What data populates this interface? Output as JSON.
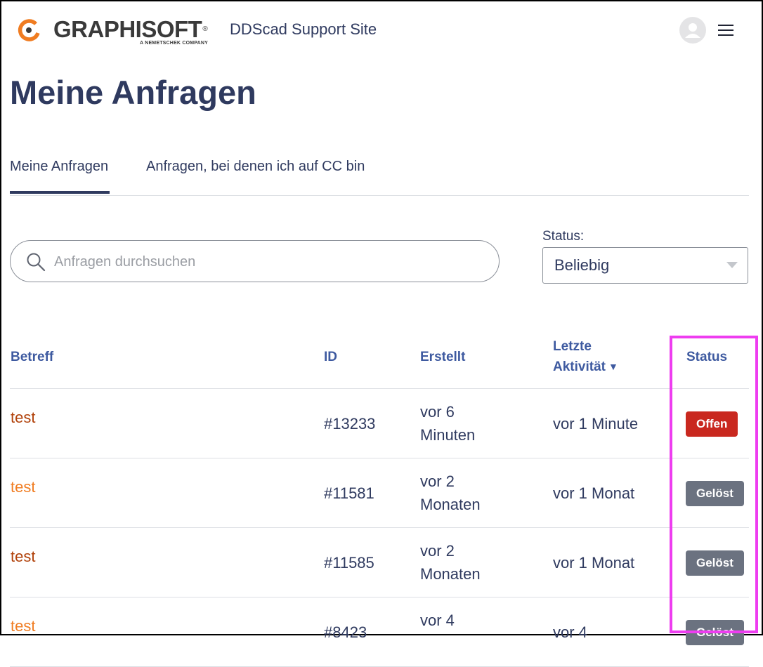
{
  "header": {
    "logo": {
      "wordmark": "GRAPHISOFT",
      "registered": "®",
      "tagline": "A NEMETSCHEK COMPANY"
    },
    "site_name": "DDScad Support Site"
  },
  "page": {
    "title": "Meine Anfragen"
  },
  "tabs": [
    {
      "label": "Meine Anfragen",
      "active": true
    },
    {
      "label": "Anfragen, bei denen ich auf CC bin",
      "active": false
    }
  ],
  "search": {
    "placeholder": "Anfragen durchsuchen",
    "value": ""
  },
  "filter": {
    "label": "Status:",
    "value": "Beliebig"
  },
  "table": {
    "columns": {
      "subject": "Betreff",
      "id": "ID",
      "created": "Erstellt",
      "activity": "Letzte Aktivität",
      "sort_indicator": "▼",
      "status": "Status"
    },
    "rows": [
      {
        "subject": "test",
        "id": "#13233",
        "created": "vor 6 Minuten",
        "activity": "vor 1 Minute",
        "status": "Offen"
      },
      {
        "subject": "test",
        "id": "#11581",
        "created": "vor 2 Monaten",
        "activity": "vor 1 Monat",
        "status": "Gelöst"
      },
      {
        "subject": "test",
        "id": "#11585",
        "created": "vor 2 Monaten",
        "activity": "vor 1 Monat",
        "status": "Gelöst"
      },
      {
        "subject": "test",
        "id": "#8423",
        "created": "vor 4",
        "activity": "vor 4",
        "status": "Gelöst"
      }
    ]
  },
  "colors": {
    "primary_text": "#2f3a5f",
    "header_link": "#3e5aa0",
    "subject_link": "#b1420b",
    "subject_link_alt": "#f07c21",
    "badge_open": "#c9281f",
    "badge_solved": "#6b7280",
    "highlight_box": "#ee3df0",
    "logo_orange": "#f07c21"
  },
  "icons": {
    "logo": "graphisoft-logo-icon",
    "avatar": "user-avatar-icon",
    "menu": "hamburger-menu-icon",
    "search": "search-icon",
    "dropdown": "chevron-down-icon"
  }
}
